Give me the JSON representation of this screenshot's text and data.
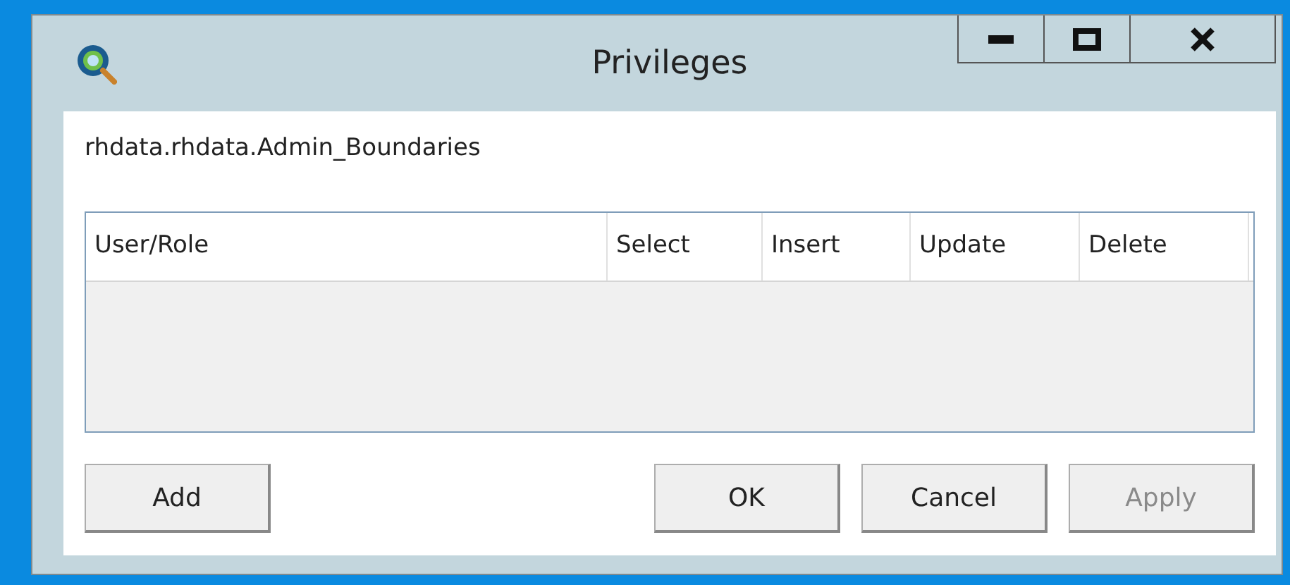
{
  "window": {
    "title": "Privileges"
  },
  "object_name": "rhdata.rhdata.Admin_Boundaries",
  "table": {
    "columns": [
      "User/Role",
      "Select",
      "Insert",
      "Update",
      "Delete"
    ]
  },
  "buttons": [
    {
      "label": "Add",
      "disabled": false
    },
    {
      "label": "OK",
      "disabled": false
    },
    {
      "label": "Cancel",
      "disabled": false
    },
    {
      "label": "Apply",
      "disabled": true
    }
  ]
}
